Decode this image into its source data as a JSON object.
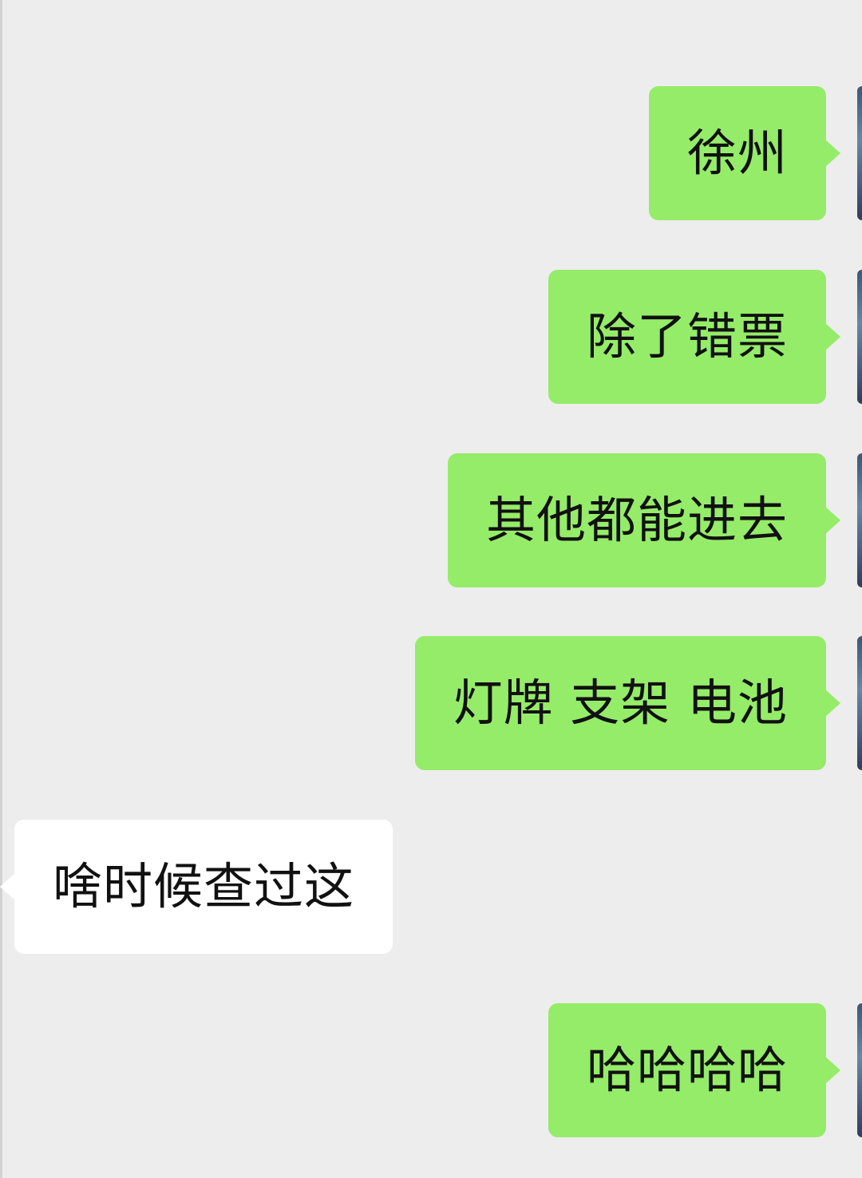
{
  "chat": {
    "messages": [
      {
        "direction": "sent",
        "text": "徐州"
      },
      {
        "direction": "sent",
        "text": "除了错票"
      },
      {
        "direction": "sent",
        "text": "其他都能进去"
      },
      {
        "direction": "sent",
        "text": "灯牌 支架 电池"
      },
      {
        "direction": "received",
        "text": "啥时候查过这"
      },
      {
        "direction": "sent",
        "text": "哈哈哈哈"
      }
    ]
  },
  "colors": {
    "background": "#ededed",
    "sent_bubble": "#95ec69",
    "received_bubble": "#ffffff",
    "text": "#111111"
  }
}
